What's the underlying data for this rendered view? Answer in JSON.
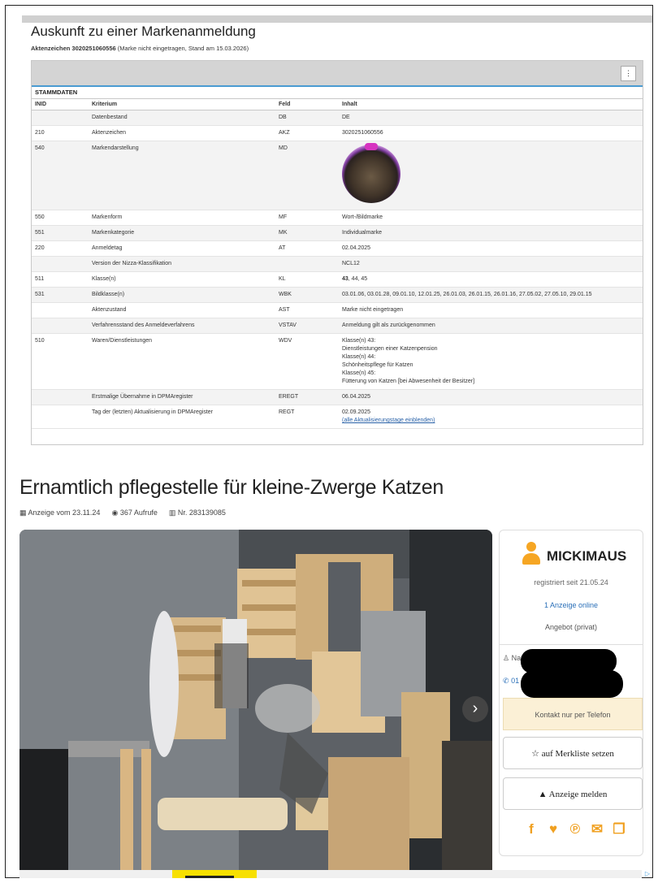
{
  "header": {
    "title": "Auskunft zu einer Markenanmeldung",
    "aktenzeichen_label": "Aktenzeichen 3020251060556",
    "aktenzeichen_note": "(Marke nicht eingetragen, Stand am 15.03.2026)"
  },
  "table": {
    "menu_glyph": "⋮",
    "section_title": "STAMMDATEN",
    "columns": [
      "INID",
      "Kriterium",
      "Feld",
      "Inhalt"
    ],
    "rows": [
      {
        "inid": "",
        "kriterium": "Datenbestand",
        "feld": "DB",
        "inhalt": "DE"
      },
      {
        "inid": "210",
        "kriterium": "Aktenzeichen",
        "feld": "AKZ",
        "inhalt": "3020251060556"
      },
      {
        "inid": "540",
        "kriterium": "Markendarstellung",
        "feld": "MD",
        "inhalt": ""
      },
      {
        "inid": "550",
        "kriterium": "Markenform",
        "feld": "MF",
        "inhalt": "Wort-/Bildmarke"
      },
      {
        "inid": "551",
        "kriterium": "Markenkategorie",
        "feld": "MK",
        "inhalt": "Individualmarke"
      },
      {
        "inid": "220",
        "kriterium": "Anmeldetag",
        "feld": "AT",
        "inhalt": "02.04.2025"
      },
      {
        "inid": "",
        "kriterium": "Version der Nizza-Klassifikation",
        "feld": "",
        "inhalt": "NCL12"
      },
      {
        "inid": "511",
        "kriterium": "Klasse(n)",
        "feld": "KL",
        "inhalt_bold": "43",
        "inhalt": ", 44, 45"
      },
      {
        "inid": "531",
        "kriterium": "Bildklasse(n)",
        "feld": "WBK",
        "inhalt": "03.01.06, 03.01.28, 09.01.10, 12.01.25, 26.01.03, 26.01.15, 26.01.16, 27.05.02, 27.05.10, 29.01.15"
      },
      {
        "inid": "",
        "kriterium": "Aktenzustand",
        "feld": "AST",
        "inhalt": "Marke nicht eingetragen"
      },
      {
        "inid": "",
        "kriterium": "Verfahrensstand des Anmeldeverfahrens",
        "feld": "VSTAV",
        "inhalt": "Anmeldung gilt als zurückgenommen"
      },
      {
        "inid": "510",
        "kriterium": "Waren/Dienstleistungen",
        "feld": "WDV",
        "inhalt_lines": [
          "Klasse(n) 43:",
          "Dienstleistungen einer Katzenpension",
          "Klasse(n) 44:",
          "Schönheitspflege für Katzen",
          "Klasse(n) 45:",
          "Fütterung von Katzen [bei Abwesenheit der Besitzer]"
        ]
      },
      {
        "inid": "",
        "kriterium": "Erstmalige Übernahme in DPMAregister",
        "feld": "EREGT",
        "inhalt": "06.04.2025"
      },
      {
        "inid": "",
        "kriterium": "Tag der (letzten) Aktualisierung in DPMAregister",
        "feld": "REGT",
        "inhalt": "02.09.2025",
        "inhalt_link": "(alle Aktualisierungstage einblenden)"
      }
    ]
  },
  "ad": {
    "title": "Ernamtlich pflegestelle für kleine-Zwerge Katzen",
    "meta": {
      "date": "Anzeige vom 23.11.24",
      "views": "367 Aufrufe",
      "number": "Nr. 283139085"
    }
  },
  "seller": {
    "username": "MICKIMAUS",
    "registered": "registriert seit 21.05.24",
    "ads_online": "1 Anzeige online",
    "offer_type": "Angebot (privat)",
    "name_prefix": "Nam",
    "phone_prefix": "01",
    "contact_note": "Kontakt nur per Telefon",
    "watchlist_button": "auf Merkliste setzen",
    "report_button": "Anzeige melden"
  },
  "icons": {
    "calendar": "calendar-icon",
    "eye": "eye-icon",
    "barcode": "barcode-icon",
    "user": "user-icon",
    "phone": "phone-icon",
    "star": "star-icon",
    "warning": "warning-icon",
    "next": "chevron-right-icon"
  },
  "colors": {
    "accent_orange": "#f6a623",
    "link_blue": "#2a6fb8",
    "table_header_blue": "#4a9bd1"
  }
}
